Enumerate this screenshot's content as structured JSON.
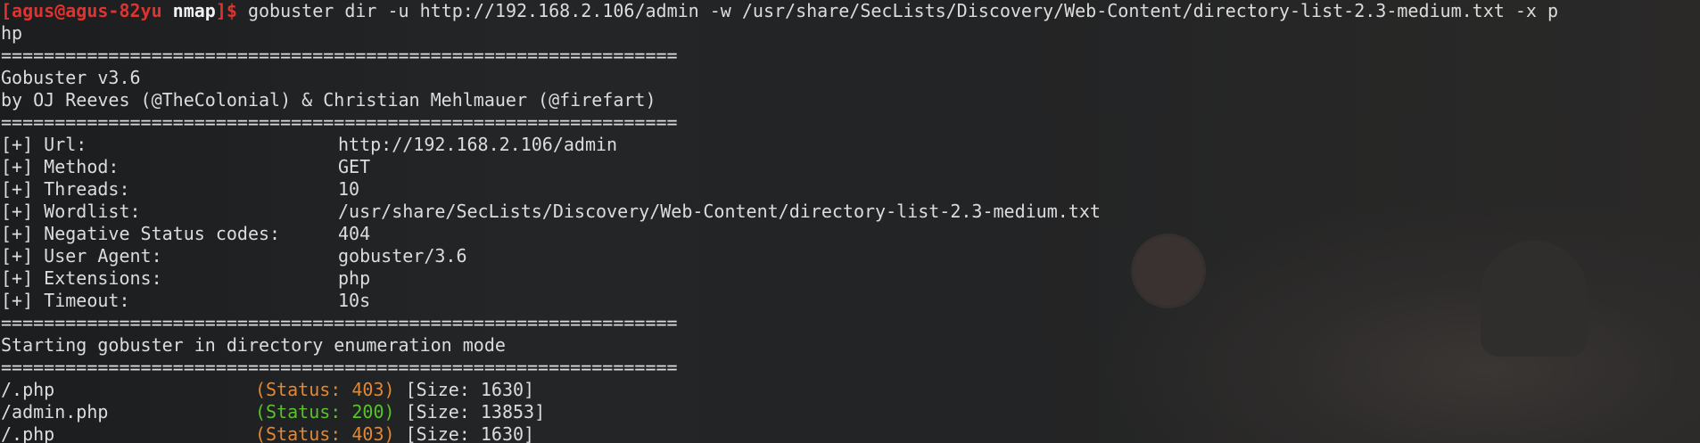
{
  "prompt": {
    "open_bracket": "[",
    "user_host": "agus@agus-82yu",
    "dir": "nmap",
    "close_bracket": "]$",
    "command": " gobuster dir -u http://192.168.2.106/admin -w /usr/share/SecLists/Discovery/Web-Content/directory-list-2.3-medium.txt -x p",
    "command_wrap": "hp"
  },
  "separator": "===============================================================",
  "banner": {
    "version": "Gobuster v3.6",
    "authors": "by OJ Reeves (@TheColonial) & Christian Mehlmauer (@firefart)"
  },
  "config": [
    {
      "label": "[+] Url:",
      "value": "http://192.168.2.106/admin"
    },
    {
      "label": "[+] Method:",
      "value": "GET"
    },
    {
      "label": "[+] Threads:",
      "value": "10"
    },
    {
      "label": "[+] Wordlist:",
      "value": "/usr/share/SecLists/Discovery/Web-Content/directory-list-2.3-medium.txt"
    },
    {
      "label": "[+] Negative Status codes:",
      "value": "404"
    },
    {
      "label": "[+] User Agent:",
      "value": "gobuster/3.6"
    },
    {
      "label": "[+] Extensions:",
      "value": "php"
    },
    {
      "label": "[+] Timeout:",
      "value": "10s"
    }
  ],
  "start_message": "Starting gobuster in directory enumeration mode",
  "results": [
    {
      "path": "/.php",
      "status": "(Status: 403)",
      "status_color": "#e8862d",
      "size": "[Size: 1630]"
    },
    {
      "path": "/admin.php",
      "status": "(Status: 200)",
      "status_color": "#57c428",
      "size": "[Size: 13853]"
    },
    {
      "path": "/.php",
      "status": "(Status: 403)",
      "status_color": "#e8862d",
      "size": "[Size: 1630]"
    }
  ],
  "colors": {
    "prompt": "#e0332f",
    "text": "#dcdcdc",
    "status_403": "#e8862d",
    "status_200": "#57c428",
    "background": "#1c1e20"
  }
}
